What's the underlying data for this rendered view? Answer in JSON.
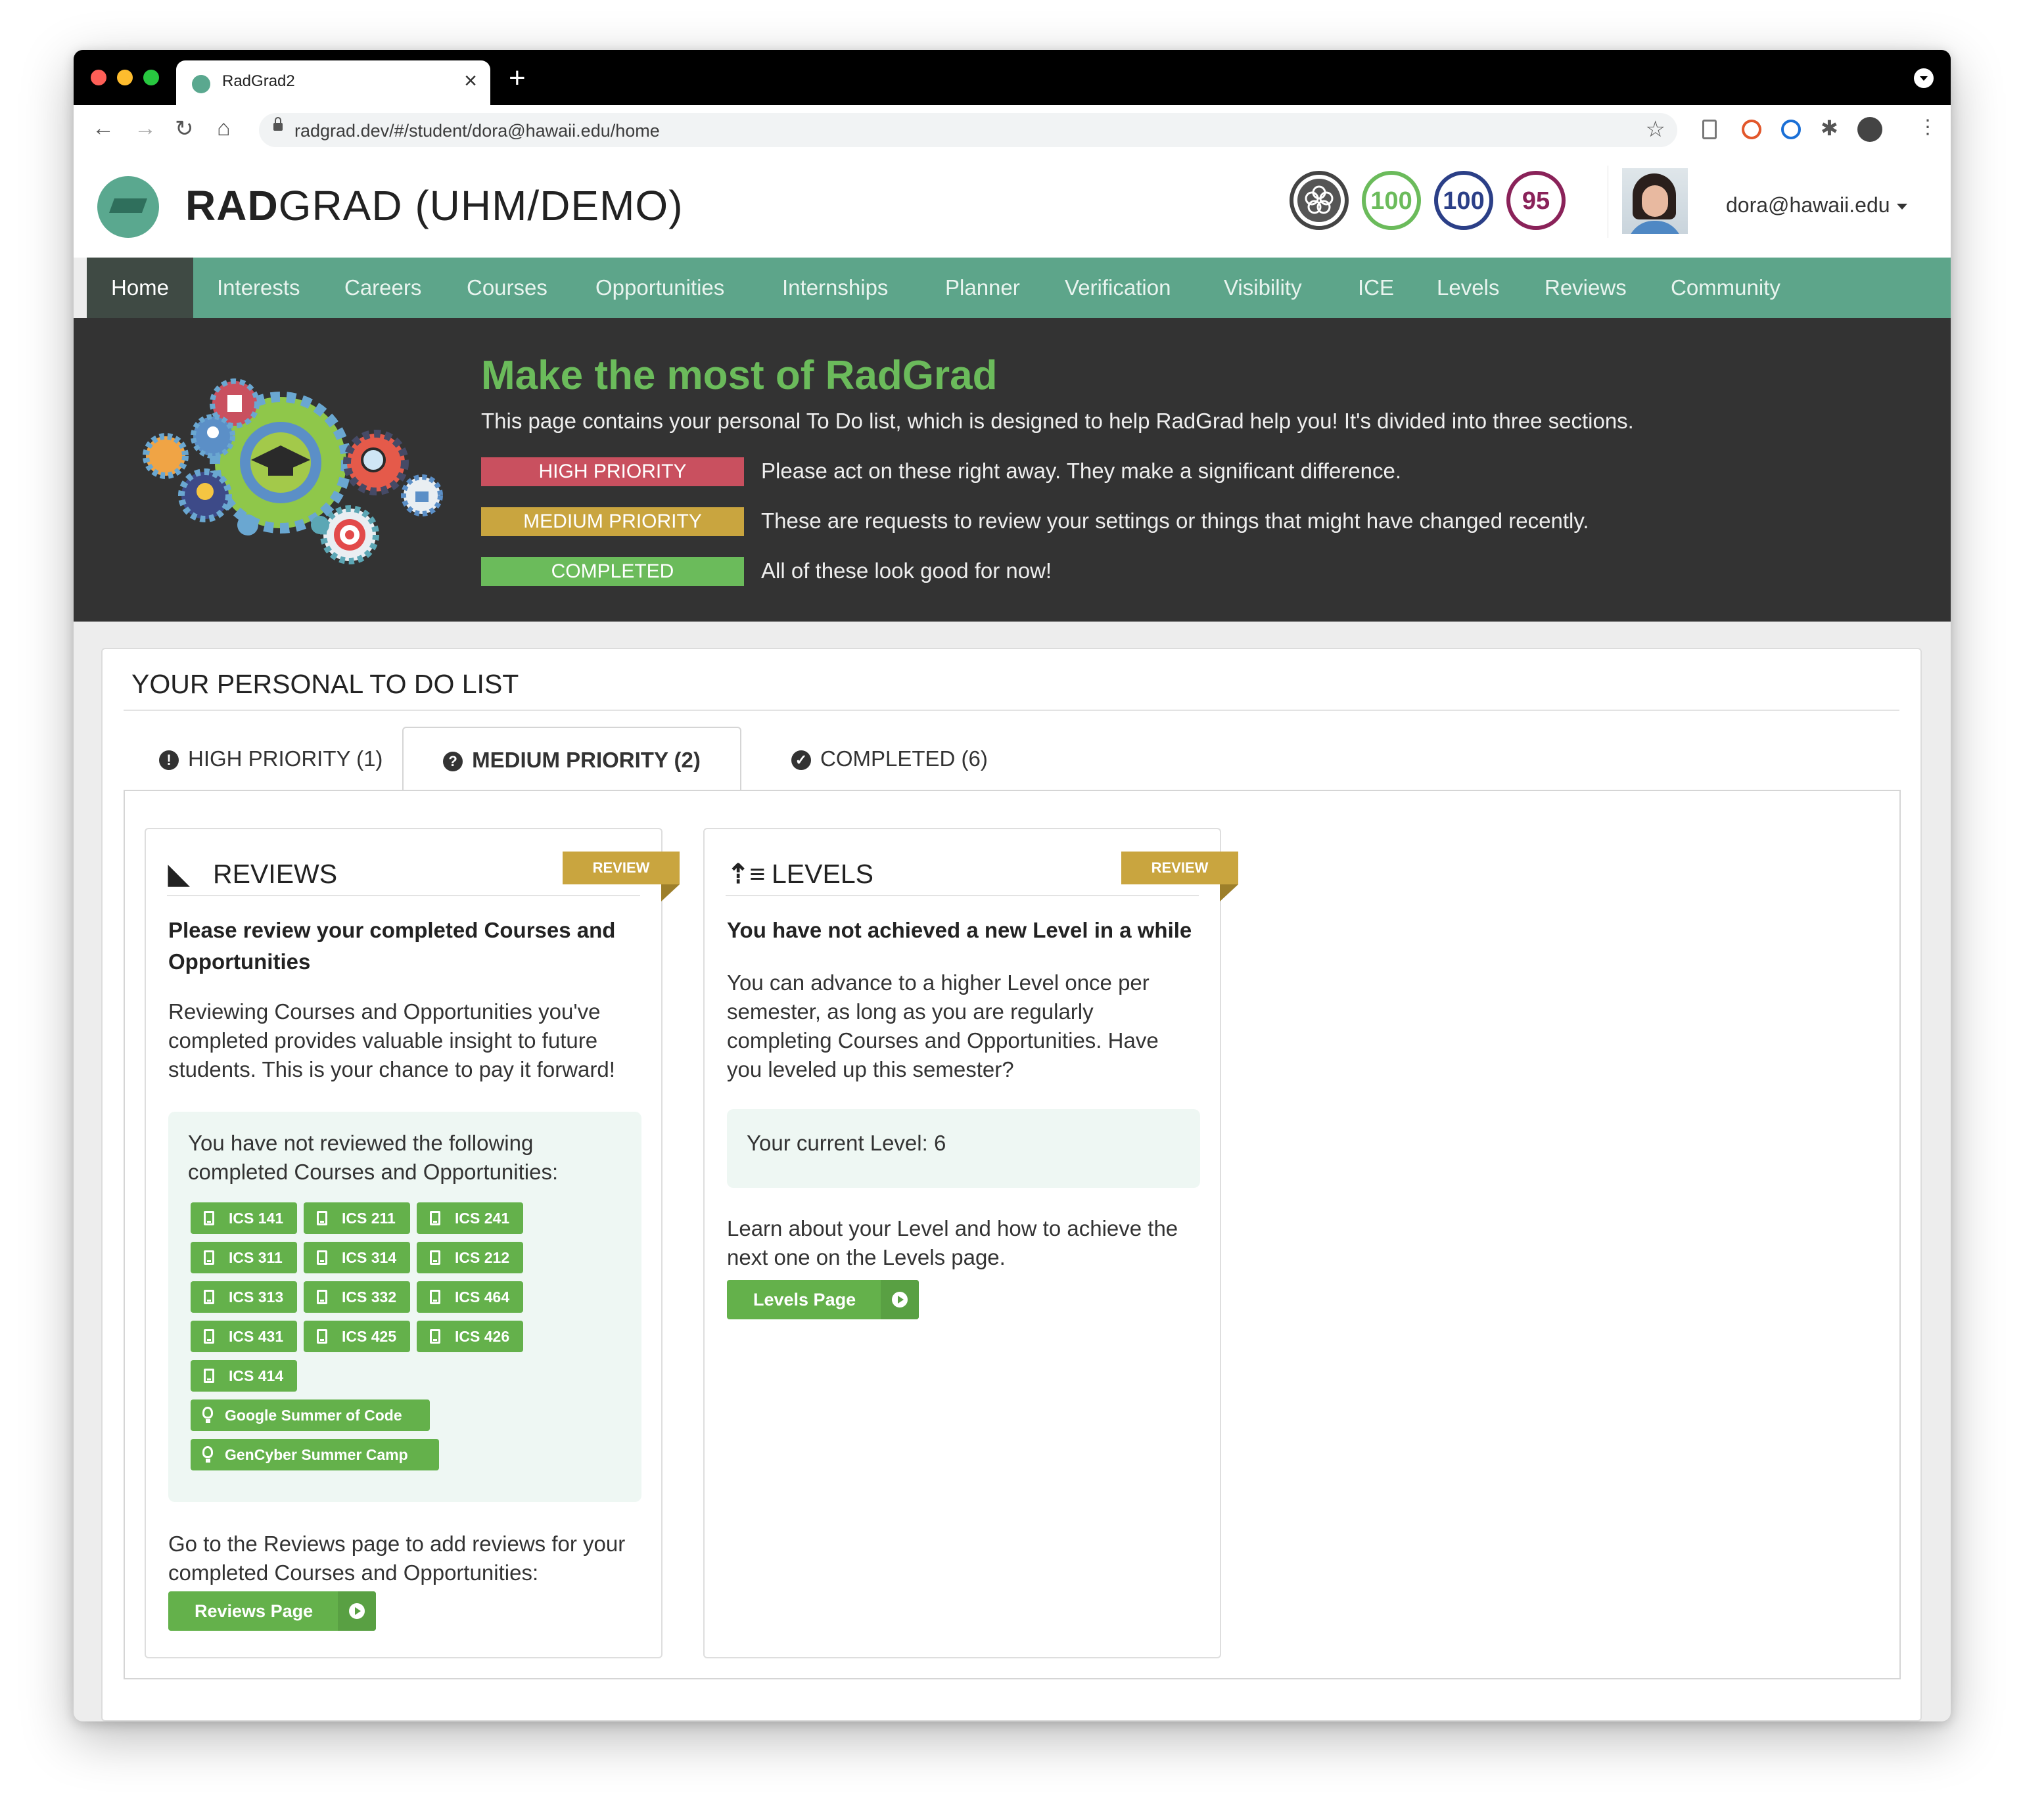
{
  "browser": {
    "tab_title": "RadGrad2",
    "url": "radgrad.dev/#/student/dora@hawaii.edu/home"
  },
  "header": {
    "brand_bold": "RAD",
    "brand_rest": "GRAD (UHM/DEMO)",
    "scores": [
      {
        "value": "100",
        "color": "#6bbb5b"
      },
      {
        "value": "100",
        "color": "#2b3f87"
      },
      {
        "value": "95",
        "color": "#8a2259"
      }
    ],
    "user_email": "dora@hawaii.edu"
  },
  "menu": [
    "Home",
    "Interests",
    "Careers",
    "Courses",
    "Opportunities",
    "Internships",
    "Planner",
    "Verification",
    "Visibility",
    "ICE",
    "Levels",
    "Reviews",
    "Community"
  ],
  "banner": {
    "title": "Make the most of RadGrad",
    "text": "This page contains your personal To Do list, which is designed to help RadGrad help you! It's divided into three sections.",
    "legend": [
      {
        "label": "HIGH PRIORITY",
        "text": "Please act on these right away. They make a significant difference.",
        "color": "#c9505f"
      },
      {
        "label": "MEDIUM PRIORITY",
        "text": "These are requests to review your settings or things that might have changed recently.",
        "color": "#c9a53f"
      },
      {
        "label": "COMPLETED",
        "text": "All of these look good for now!",
        "color": "#6bbb5b"
      }
    ]
  },
  "todo": {
    "title": "YOUR PERSONAL TO DO LIST",
    "tabs": {
      "high": "HIGH PRIORITY (1)",
      "medium": "MEDIUM PRIORITY (2)",
      "completed": "COMPLETED (6)"
    },
    "reviews": {
      "heading": "REVIEWS",
      "ribbon": "REVIEW",
      "strong": "Please review your completed Courses and Opportunities",
      "para": "Reviewing Courses and Opportunities you've completed provides valuable insight to future students. This is your chance to pay it forward!",
      "box_text": "You have not reviewed the following completed Courses and Opportunities:",
      "courses": [
        "ICS 141",
        "ICS 211",
        "ICS 241",
        "ICS 311",
        "ICS 314",
        "ICS 212",
        "ICS 313",
        "ICS 332",
        "ICS 464",
        "ICS 431",
        "ICS 425",
        "ICS 426",
        "ICS 414"
      ],
      "opportunities": [
        "Google Summer of Code",
        "GenCyber Summer Camp"
      ],
      "footer": "Go to the Reviews page to add reviews for your completed Courses and Opportunities:",
      "button": "Reviews Page"
    },
    "levels": {
      "heading": "LEVELS",
      "ribbon": "REVIEW",
      "strong": "You have not achieved a new Level in a while",
      "para": "You can advance to a higher Level once per semester, as long as you are regularly completing Courses and Opportunities. Have you leveled up this semester?",
      "box_text": "Your current Level: 6",
      "footer": "Learn about your Level and how to achieve the next one on the Levels page.",
      "button": "Levels Page"
    }
  }
}
